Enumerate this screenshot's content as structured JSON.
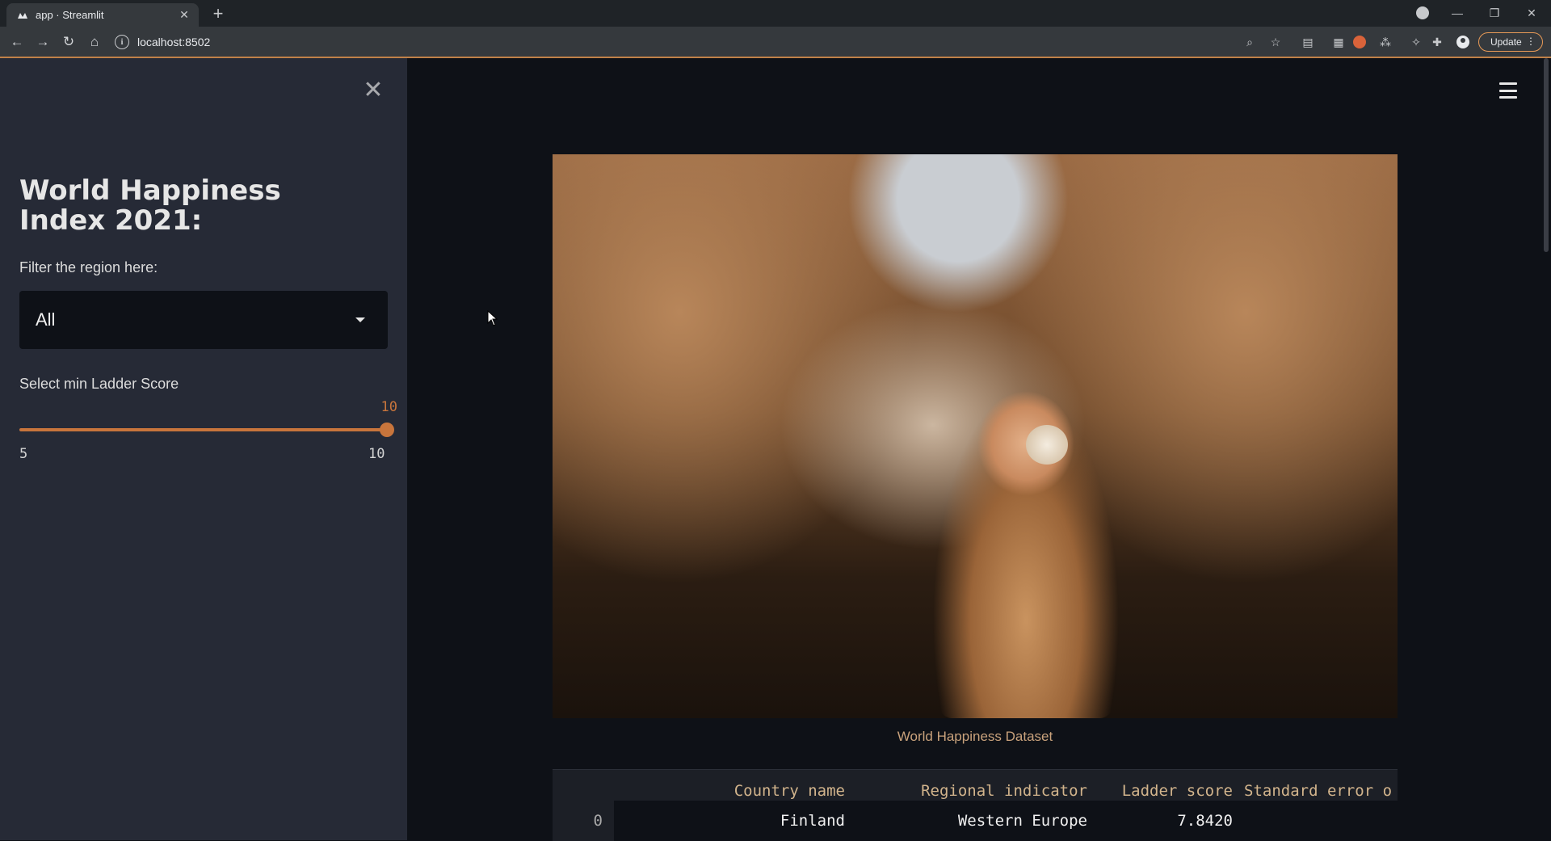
{
  "browser": {
    "tab_title": "app · Streamlit",
    "url": "localhost:8502",
    "update_label": "Update"
  },
  "sidebar": {
    "title": "World Happiness Index 2021:",
    "region_filter_label": "Filter the region here:",
    "region_selected": "All",
    "ladder_slider_label": "Select min Ladder Score",
    "ladder_slider_value": "10",
    "ladder_slider_min": "5",
    "ladder_slider_max": "10"
  },
  "main": {
    "image_caption": "World Happiness Dataset",
    "table": {
      "columns": [
        "Country name",
        "Regional indicator",
        "Ladder score",
        "Standard error o"
      ],
      "rows": [
        {
          "index": "0",
          "cells": [
            "Finland",
            "Western Europe",
            "7.8420",
            ""
          ]
        }
      ]
    }
  },
  "colors": {
    "accent": "#c8753c",
    "sidebar_bg": "#262a36",
    "main_bg": "#0e1117"
  }
}
